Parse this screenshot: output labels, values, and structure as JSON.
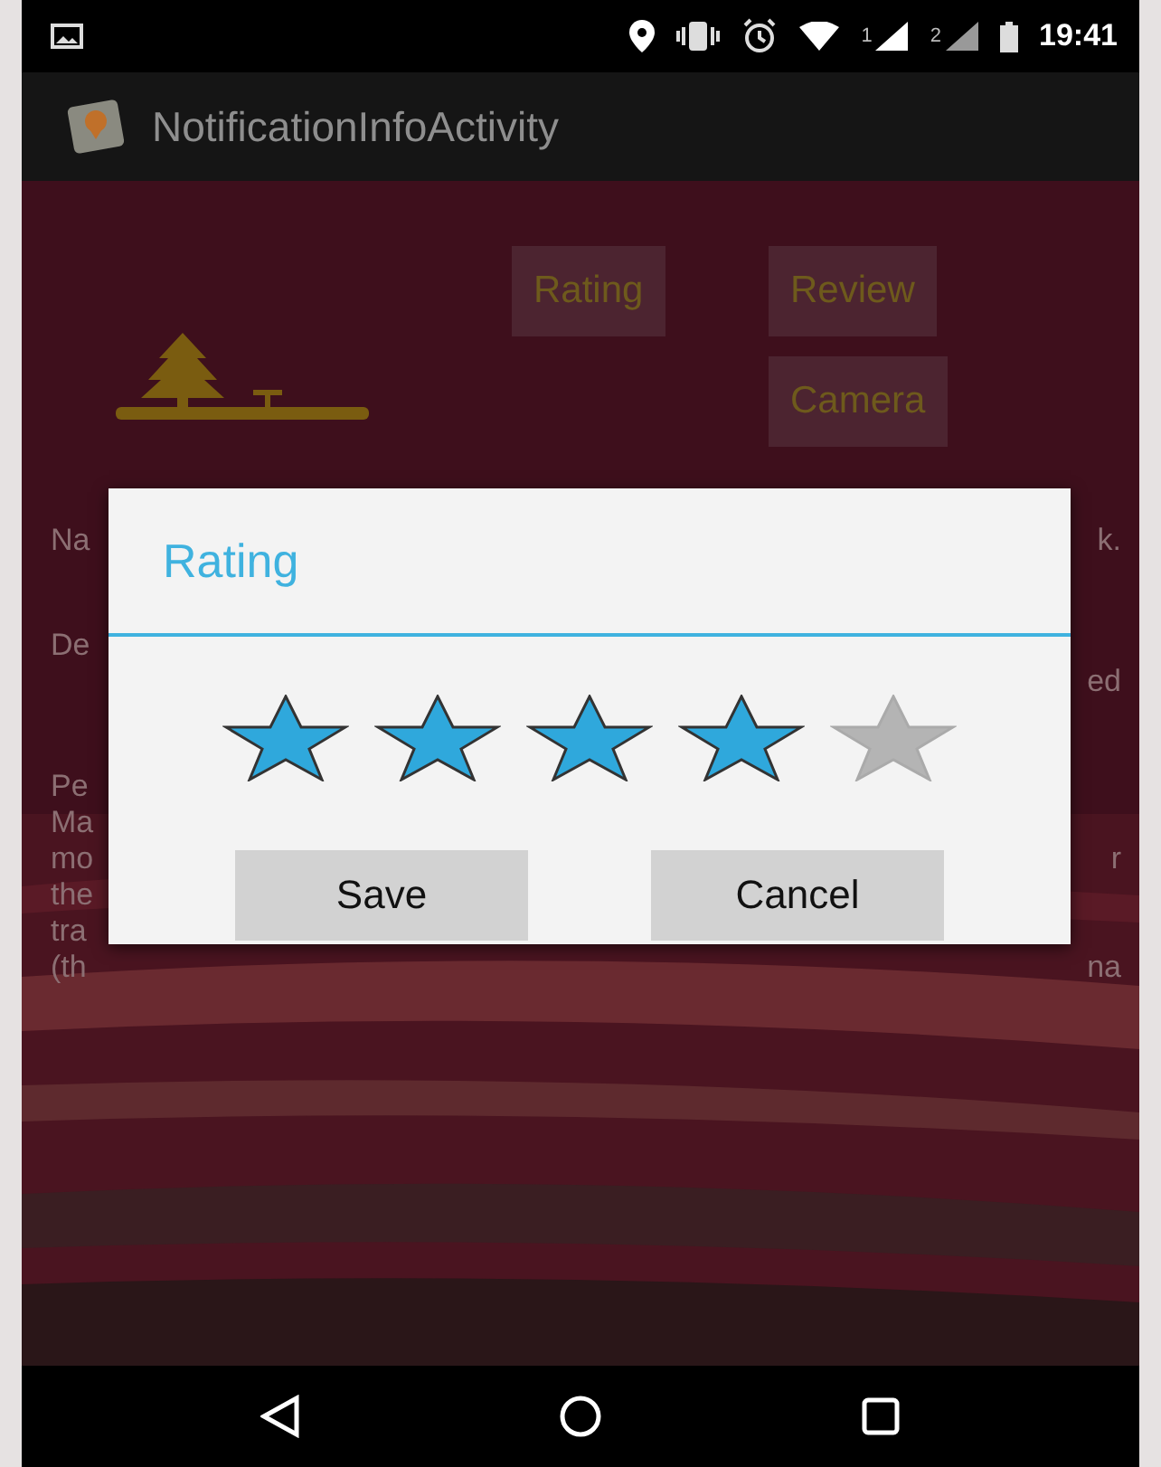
{
  "status_bar": {
    "signals": [
      "1",
      "2"
    ],
    "time": "19:41"
  },
  "action_bar": {
    "title": "NotificationInfoActivity"
  },
  "content": {
    "buttons": [
      {
        "label": "Rating"
      },
      {
        "label": "Review"
      },
      {
        "label": "Camera"
      }
    ],
    "paragraphs": [
      [
        {
          "left": "Na",
          "right": "k."
        }
      ],
      [
        {
          "left": "De"
        },
        {
          "right": "ed"
        }
      ],
      [
        {
          "left": "Pe"
        },
        {
          "left": "Ma"
        },
        {
          "left": "mo",
          "right": "r"
        },
        {
          "left": "the"
        },
        {
          "left": "tra"
        },
        {
          "left": "(th",
          "right": "na"
        }
      ]
    ]
  },
  "dialog": {
    "title": "Rating",
    "stars": 4,
    "buttons": [
      {
        "label": "Save"
      },
      {
        "label": "Cancel"
      }
    ]
  }
}
